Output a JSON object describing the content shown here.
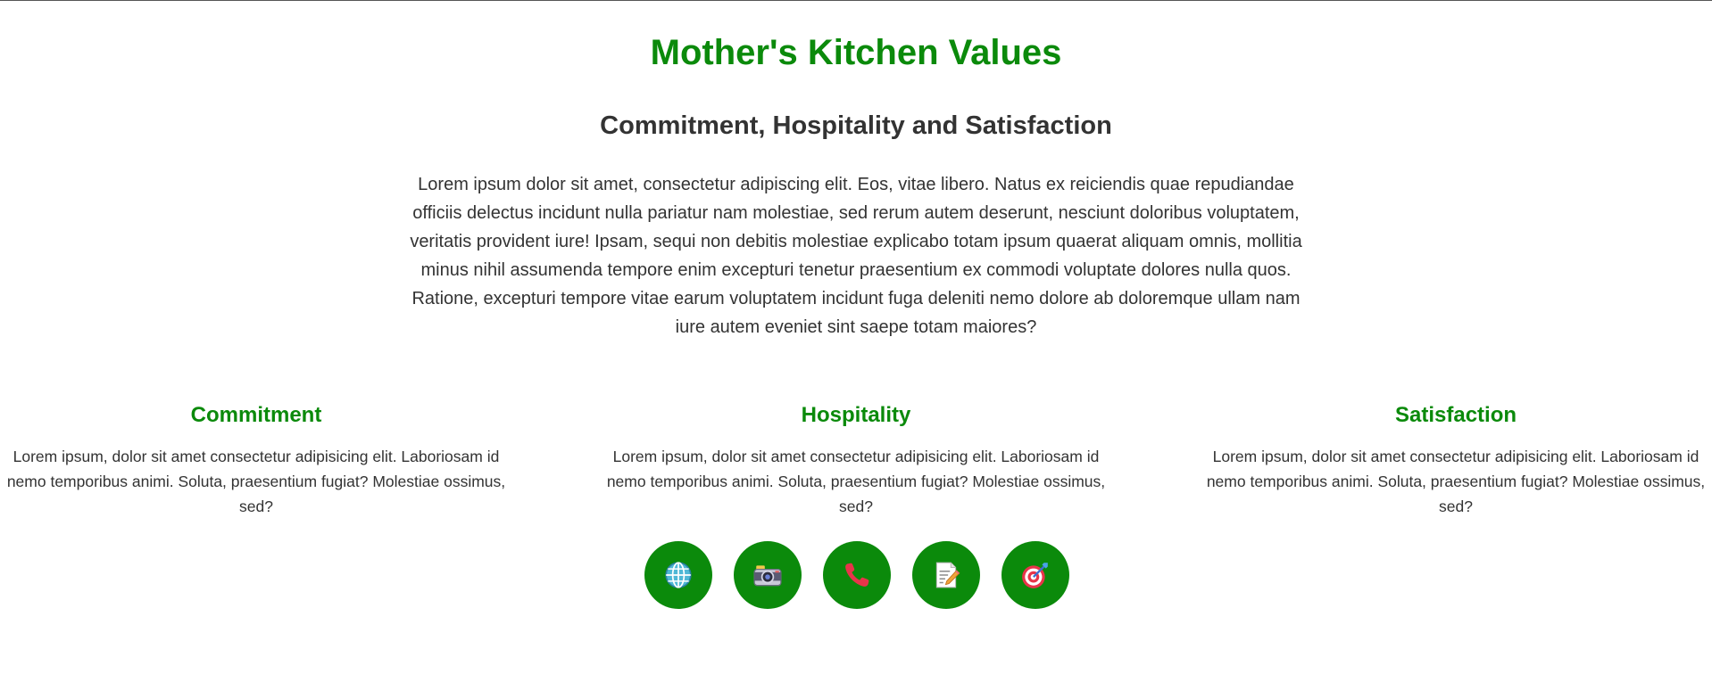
{
  "header": {
    "title": "Mother's Kitchen Values",
    "subtitle": "Commitment, Hospitality and Satisfaction",
    "intro": "Lorem ipsum dolor sit amet, consectetur adipiscing elit. Eos, vitae libero. Natus ex reiciendis quae repudiandae officiis delectus incidunt nulla pariatur nam molestiae, sed rerum autem deserunt, nesciunt doloribus voluptatem, veritatis provident iure! Ipsam, sequi non debitis molestiae explicabo totam ipsum quaerat aliquam omnis, mollitia minus nihil assumenda tempore enim excepturi tenetur praesentium ex commodi voluptate dolores nulla quos. Ratione, excepturi tempore vitae earum voluptatem incidunt fuga deleniti nemo dolore ab doloremque ullam nam iure autem eveniet sint saepe totam maiores?"
  },
  "values": [
    {
      "title": "Commitment",
      "text": "Lorem ipsum, dolor sit amet consectetur adipisicing elit. Laboriosam id nemo temporibus animi. Soluta, praesentium fugiat? Molestiae ossimus, sed?"
    },
    {
      "title": "Hospitality",
      "text": "Lorem ipsum, dolor sit amet consectetur adipisicing elit. Laboriosam id nemo temporibus animi. Soluta, praesentium fugiat? Molestiae ossimus, sed?"
    },
    {
      "title": "Satisfaction",
      "text": "Lorem ipsum, dolor sit amet consectetur adipisicing elit. Laboriosam id nemo temporibus animi. Soluta, praesentium fugiat? Molestiae ossimus, sed?"
    }
  ],
  "social_icons": [
    "globe-icon",
    "camera-icon",
    "phone-icon",
    "memo-icon",
    "target-icon"
  ],
  "colors": {
    "accent_green": "#0b8a0b",
    "text": "#333333",
    "background": "#ffffff"
  }
}
